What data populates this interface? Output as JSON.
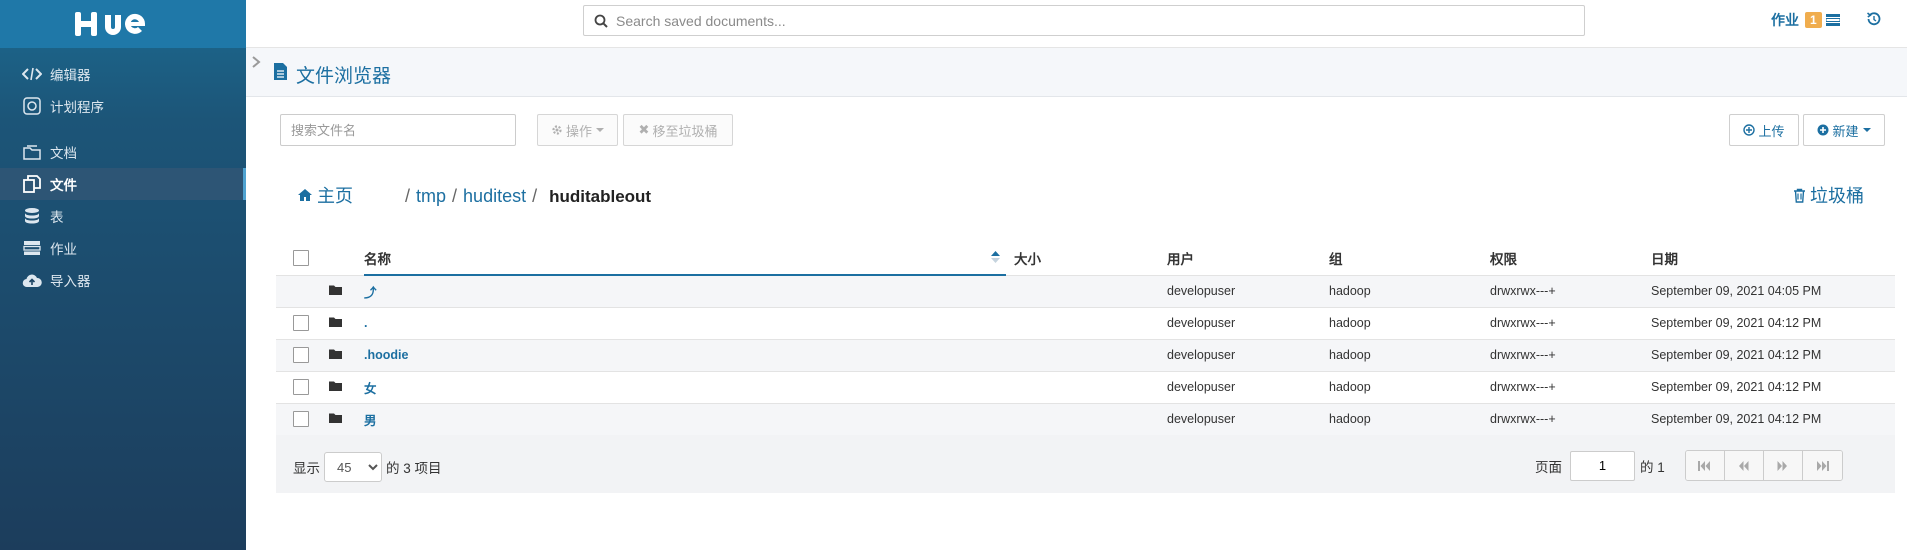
{
  "app": {
    "logo_text": "HUE"
  },
  "sidebar": {
    "items": [
      {
        "label": "编辑器",
        "icon": "code-icon"
      },
      {
        "label": "计划程序",
        "icon": "scheduler-icon"
      },
      {
        "label": "文档",
        "icon": "documents-icon"
      },
      {
        "label": "文件",
        "icon": "files-icon",
        "active": true
      },
      {
        "label": "表",
        "icon": "database-icon"
      },
      {
        "label": "作业",
        "icon": "jobs-icon"
      },
      {
        "label": "导入器",
        "icon": "cloud-upload-icon"
      }
    ]
  },
  "topbar": {
    "search_placeholder": "Search saved documents...",
    "jobs_label": "作业",
    "jobs_count": "1"
  },
  "page": {
    "title": "文件浏览器"
  },
  "toolbar": {
    "file_search_placeholder": "搜索文件名",
    "actions_label": "操作",
    "move_to_trash_label": "移至垃圾桶",
    "upload_label": "上传",
    "new_label": "新建"
  },
  "breadcrumb": {
    "home_label": "主页",
    "segments": [
      "tmp",
      "huditest"
    ],
    "current": "huditableout",
    "trash_label": "垃圾桶"
  },
  "table": {
    "headers": {
      "name": "名称",
      "size": "大小",
      "user": "用户",
      "group": "组",
      "permissions": "权限",
      "date": "日期"
    },
    "rows": [
      {
        "name": "⤴",
        "size": "",
        "user": "developuser",
        "group": "hadoop",
        "permissions": "drwxrwx---+",
        "date": "September 09, 2021 04:05 PM",
        "checkbox": false
      },
      {
        "name": ".",
        "size": "",
        "user": "developuser",
        "group": "hadoop",
        "permissions": "drwxrwx---+",
        "date": "September 09, 2021 04:12 PM",
        "checkbox": true
      },
      {
        "name": ".hoodie",
        "size": "",
        "user": "developuser",
        "group": "hadoop",
        "permissions": "drwxrwx---+",
        "date": "September 09, 2021 04:12 PM",
        "checkbox": true
      },
      {
        "name": "女",
        "size": "",
        "user": "developuser",
        "group": "hadoop",
        "permissions": "drwxrwx---+",
        "date": "September 09, 2021 04:12 PM",
        "checkbox": true
      },
      {
        "name": "男",
        "size": "",
        "user": "developuser",
        "group": "hadoop",
        "permissions": "drwxrwx---+",
        "date": "September 09, 2021 04:12 PM",
        "checkbox": true
      }
    ]
  },
  "footer": {
    "show_label": "显示",
    "page_size": "45",
    "items_label": "的 3 项目",
    "page_label": "页面",
    "page_value": "1",
    "of_label": "的 1"
  },
  "colors": {
    "brand": "#1f78a8",
    "link": "#1c6fa1",
    "badge": "#f0ad4e"
  }
}
